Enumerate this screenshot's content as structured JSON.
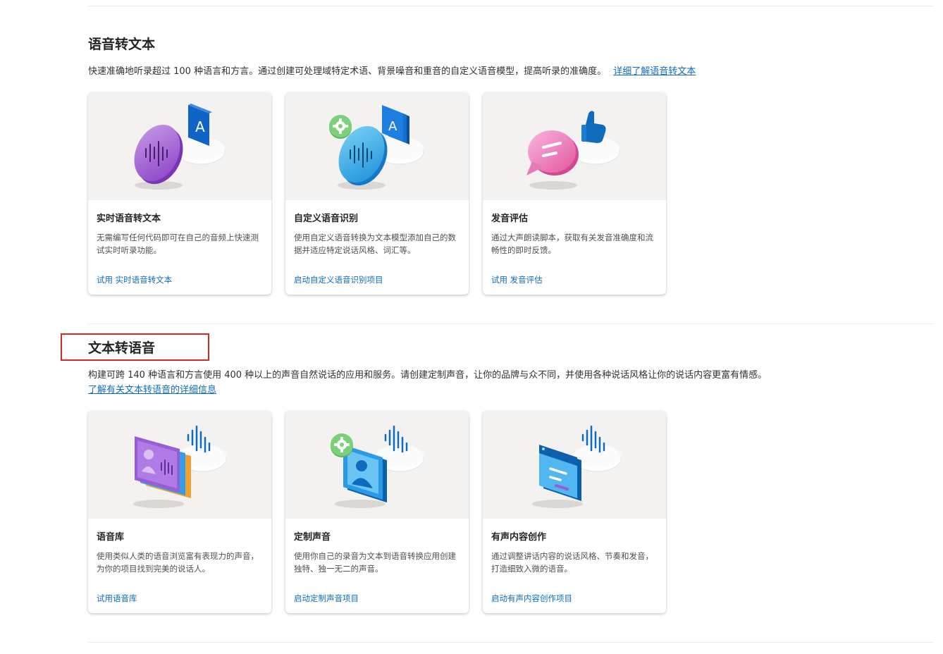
{
  "stt": {
    "title": "语音转文本",
    "description": "快速准确地听录超过 100 种语言和方言。通过创建可处理域特定术语、背景噪音和重音的自定义语音模型，提高听录的准确度。",
    "learn_more": "详细了解语音转文本",
    "cards": [
      {
        "title": "实时语音转文本",
        "description": "无需编写任何代码即可在自己的音频上快速测试实时听录功能。",
        "link": "试用 实时语音转文本"
      },
      {
        "title": "自定义语音识别",
        "description": "使用自定义语音转换为文本模型添加自己的数据并适应特定说话风格、词汇等。",
        "link": "启动自定义语音识别项目"
      },
      {
        "title": "发音评估",
        "description": "通过大声朗读脚本，获取有关发音准确度和流畅性的即时反馈。",
        "link": "试用 发音评估"
      }
    ]
  },
  "tts": {
    "title": "文本转语音",
    "description": "构建可跨 140 种语言和方言使用 400 种以上的声音自然说话的应用和服务。请创建定制声音，让你的品牌与众不同，并使用各种说话风格让你的说话内容更富有情感。",
    "learn_more": "了解有关文本转语音的详细信息",
    "cards": [
      {
        "title": "语音库",
        "description": "使用类似人类的语音浏览富有表现力的声音，为你的项目找到完美的说话人。",
        "link": "试用语音库"
      },
      {
        "title": "定制声音",
        "description": "使用你自己的录音为文本到语音转换应用创建独特、独一无二的声音。",
        "link": "启动定制声音项目"
      },
      {
        "title": "有声内容创作",
        "description": "通过调整讲话内容的说话风格、节奏和发音，打造细致入微的语音。",
        "link": "启动有声内容创作项目"
      }
    ]
  },
  "icons": {
    "letter": "A"
  }
}
